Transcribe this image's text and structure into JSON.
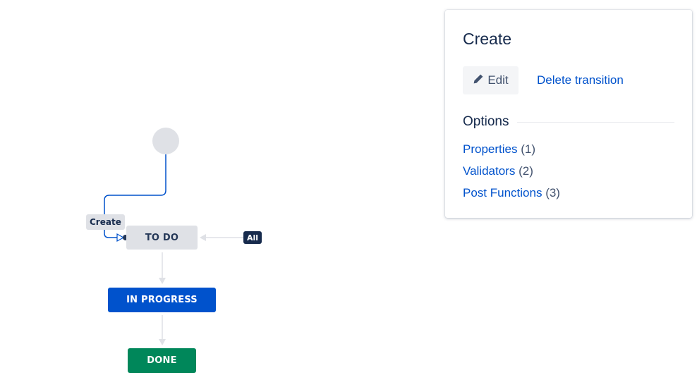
{
  "workflow": {
    "statuses": [
      {
        "label": "TO DO",
        "color": "#dfe1e6",
        "text_color": "#253858"
      },
      {
        "label": "IN PROGRESS",
        "color": "#0052cc",
        "text_color": "#ffffff"
      },
      {
        "label": "DONE",
        "color": "#00875a",
        "text_color": "#ffffff"
      }
    ],
    "create_transition_label": "Create",
    "all_transition_label": "All"
  },
  "panel": {
    "title": "Create",
    "edit_label": "Edit",
    "edit_icon": "pencil-icon",
    "delete_label": "Delete transition",
    "options_heading": "Options",
    "options": [
      {
        "label": "Properties",
        "count": "(1)"
      },
      {
        "label": "Validators",
        "count": "(2)"
      },
      {
        "label": "Post Functions",
        "count": "(3)"
      }
    ]
  },
  "colors": {
    "link": "#0052cc",
    "selected_transition": "#0052cc",
    "connector": "#dfe1e6"
  }
}
